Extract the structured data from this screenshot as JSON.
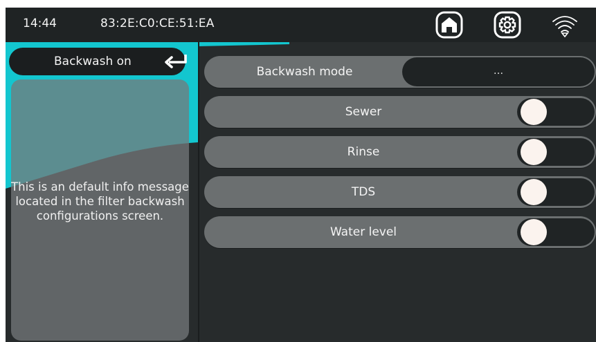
{
  "status_bar": {
    "time": "14:44",
    "mac_address": "83:2E:C0:CE:51:EA",
    "icons": [
      "home-icon",
      "gear-icon",
      "wifi-icon"
    ]
  },
  "left_panel": {
    "back_button_label": "Backwash on",
    "back_icon": "return-arrow-icon",
    "info_message": "This is an default info message located in the filter backwash configurations screen."
  },
  "settings": {
    "mode": {
      "label": "Backwash mode",
      "value": "..."
    },
    "toggles": [
      {
        "label": "Sewer",
        "state": "off"
      },
      {
        "label": "Rinse",
        "state": "off"
      },
      {
        "label": "TDS",
        "state": "off"
      },
      {
        "label": "Water level",
        "state": "off"
      }
    ]
  },
  "colors": {
    "background": "#272b2c",
    "accent": "#13c6cf",
    "row": "#6b6f70",
    "knob": "#fbf3ee"
  }
}
